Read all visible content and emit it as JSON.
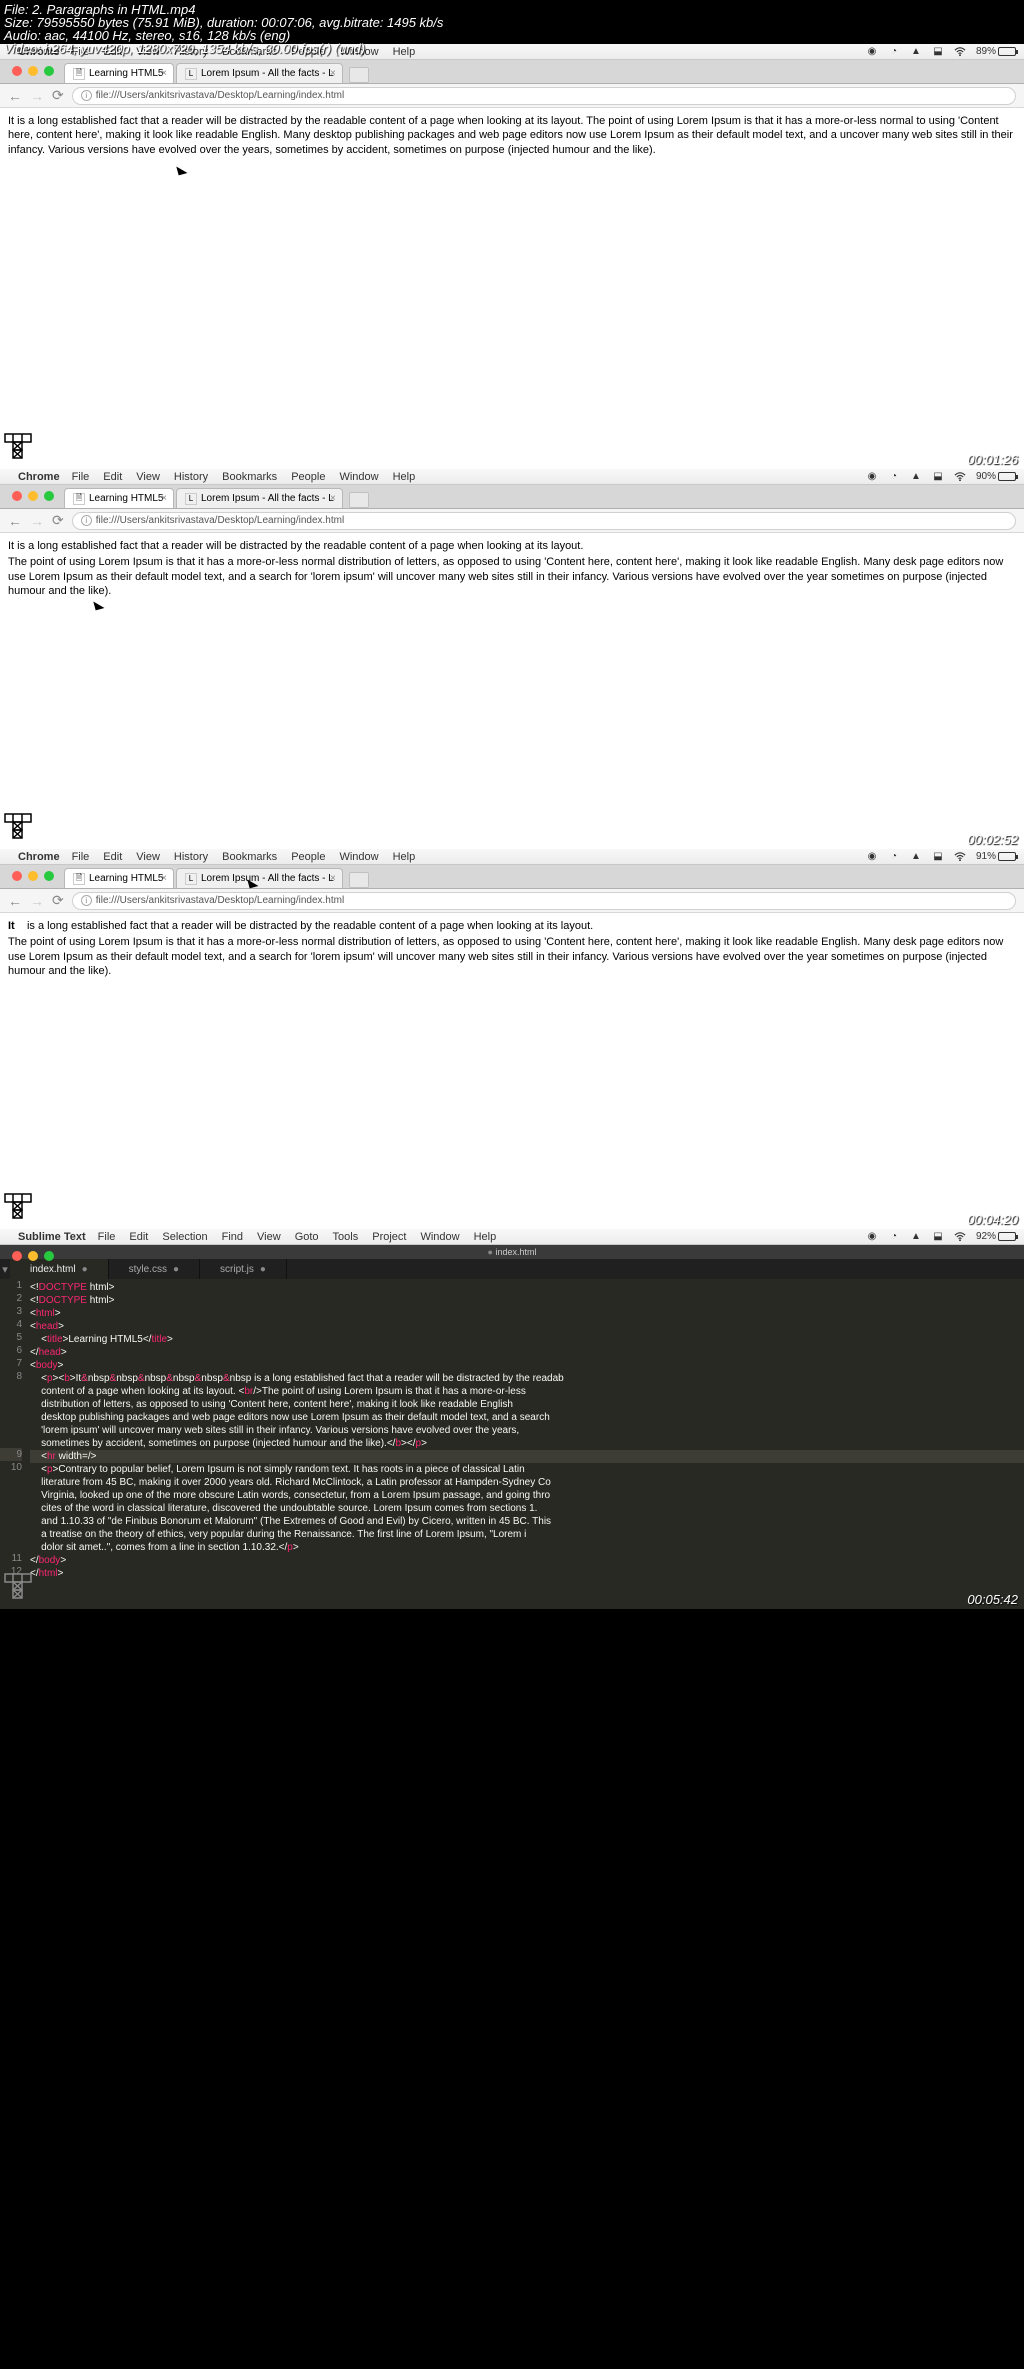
{
  "overlay": {
    "file": "File: 2. Paragraphs in HTML.mp4",
    "size": "Size: 79595550 bytes (75.91 MiB), duration: 00:07:06, avg.bitrate: 1495 kb/s",
    "audio": "Audio: aac, 44100 Hz, stereo, s16, 128 kb/s (eng)",
    "video": "Video: h264, yuv420p, 1280x720, 1354 kb/s, 30.00 fps(r) (und)"
  },
  "mac_menu": {
    "chrome": {
      "app": "Chrome",
      "items": [
        "File",
        "Edit",
        "View",
        "History",
        "Bookmarks",
        "People",
        "Window",
        "Help"
      ]
    },
    "sublime": {
      "app": "Sublime Text",
      "items": [
        "File",
        "Edit",
        "Selection",
        "Find",
        "View",
        "Goto",
        "Tools",
        "Project",
        "Window",
        "Help"
      ]
    }
  },
  "status": {
    "f1_batt": "89%",
    "f2_batt": "90%",
    "f3_batt": "91%",
    "f4_batt": "92%"
  },
  "tabs": {
    "active": "Learning HTML5",
    "other": "Lorem Ipsum - All the facts - L"
  },
  "url": "file:///Users/ankitsrivastava/Desktop/Learning/index.html",
  "frame1": {
    "p1": "It is a long established fact that a reader will be distracted by the readable content of a page when looking at its layout. The point of using Lorem Ipsum is that it has a more-or-less normal to using 'Content here, content here', making it look like readable English. Many desktop publishing packages and web page editors now use Lorem Ipsum as their default model text, and a uncover many web sites still in their infancy. Various versions have evolved over the years, sometimes by accident, sometimes on purpose (injected humour and the like).",
    "timestamp": "00:01:26"
  },
  "frame2": {
    "p1": "It is a long established fact that a reader will be distracted by the readable content of a page when looking at its layout.",
    "p2": "The point of using Lorem Ipsum is that it has a more-or-less normal distribution of letters, as opposed to using 'Content here, content here', making it look like readable English. Many desk page editors now use Lorem Ipsum as their default model text, and a search for 'lorem ipsum' will uncover many web sites still in their infancy. Various versions have evolved over the year sometimes on purpose (injected humour and the like).",
    "timestamp": "00:02:52"
  },
  "frame3": {
    "p1_prefix": "It",
    "p1_rest": "is a long established fact that a reader will be distracted by the readable content of a page when looking at its layout.",
    "p2": "The point of using Lorem Ipsum is that it has a more-or-less normal distribution of letters, as opposed to using 'Content here, content here', making it look like readable English. Many desk page editors now use Lorem Ipsum as their default model text, and a search for 'lorem ipsum' will uncover many web sites still in their infancy. Various versions have evolved over the year sometimes on purpose (injected humour and the like).",
    "timestamp": "00:04:20"
  },
  "frame4": {
    "title": "index.html",
    "tabs": [
      "index.html",
      "style.css",
      "script.js"
    ],
    "code": {
      "l1_dt": "<!",
      "l1_dt2": "DOCTYPE",
      "l1_html": " html>",
      "l2_dt": "<!",
      "l2_dt2": "DOCTYPE",
      "l2_html": " html>",
      "l3": "<html>",
      "l4": "<head>",
      "l5_open": "    <title>",
      "l5_text": "Learning HTML5",
      "l5_close": "</title>",
      "l6": "</head>",
      "l7": "<body>",
      "l8a": "    <p><b>It",
      "l8nb": "&nbsp",
      "l8sep": "&nbsp",
      "l8b": " is a long established fact that a reader will be distracted by the readab",
      "l8c": "    content of a page when looking at its layout. <br/>The point of using Lorem Ipsum is that it has a more-or-less",
      "l8d": "    distribution of letters, as opposed to using 'Content here, content here', making it look like readable English",
      "l8e": "    desktop publishing packages and web page editors now use Lorem Ipsum as their default model text, and a search ",
      "l8f": "    'lorem ipsum' will uncover many web sites still in their infancy. Various versions have evolved over the years,",
      "l8g": "    sometimes by accident, sometimes on purpose (injected humour and the like).</b></p>",
      "l9": "    <hr width=/>",
      "l10a": "    <p>Contrary to popular belief, Lorem Ipsum is not simply random text. It has roots in a piece of classical Latin",
      "l10b": "    literature from 45 BC, making it over 2000 years old. Richard McClintock, a Latin professor at Hampden-Sydney Co",
      "l10c": "    Virginia, looked up one of the more obscure Latin words, consectetur, from a Lorem Ipsum passage, and going thro",
      "l10d": "    cites of the word in classical literature, discovered the undoubtable source. Lorem Ipsum comes from sections 1.",
      "l10e": "    and 1.10.33 of \"de Finibus Bonorum et Malorum\" (The Extremes of Good and Evil) by Cicero, written in 45 BC. This",
      "l10f": "    a treatise on the theory of ethics, very popular during the Renaissance. The first line of Lorem Ipsum, \"Lorem i",
      "l10g": "    dolor sit amet..\", comes from a line in section 1.10.32.</p>",
      "l11": "</body>",
      "l12": "</html>"
    },
    "timestamp": "00:05:42"
  }
}
